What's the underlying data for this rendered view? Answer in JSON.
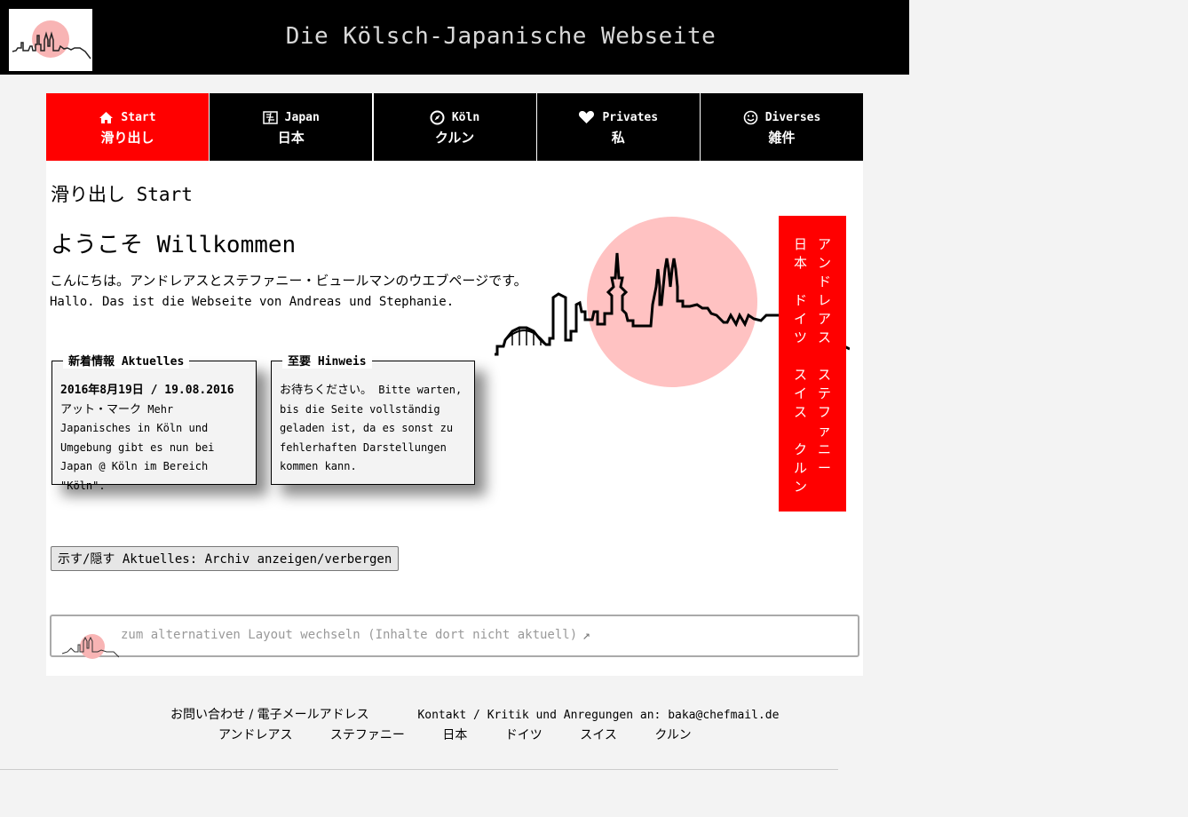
{
  "header": {
    "title": "Die Kölsch-Japanische Webseite"
  },
  "nav": [
    {
      "icon": "home-icon",
      "label_de": "Start",
      "label_jp": "滑り出し",
      "active": true
    },
    {
      "icon": "map-icon",
      "label_de": "Japan",
      "label_jp": "日本",
      "active": false
    },
    {
      "icon": "compass-icon",
      "label_de": "Köln",
      "label_jp": "クルン",
      "active": false
    },
    {
      "icon": "heart-icon",
      "label_de": "Privates",
      "label_jp": "私",
      "active": false
    },
    {
      "icon": "smiley-icon",
      "label_de": "Diverses",
      "label_jp": "雑件",
      "active": false
    }
  ],
  "main": {
    "page_title": "滑り出し Start",
    "welcome_title": "ようこそ Willkommen",
    "intro_jp": "こんにちは。アンドレアスとステファニー・ビュールマンのウエブページです。",
    "intro_de": "Hallo. Das ist die Webseite von Andreas und Stephanie."
  },
  "sidebar": {
    "names": [
      "ア",
      "ン",
      "ド",
      "レ",
      "ア",
      "ス",
      "",
      "ス",
      "テ",
      "フ",
      "ァ",
      "ニ",
      "ー"
    ],
    "places": [
      "日",
      "本",
      "",
      "ド",
      "イ",
      "ツ",
      "",
      "ス",
      "イ",
      "ス",
      "",
      "ク",
      "ル",
      "ン"
    ]
  },
  "news": {
    "legend": "新着情報 Aktuelles",
    "date": "2016年8月19日 / 19.08.2016",
    "text_jp": "アット・マーク",
    "text": "Mehr Japanisches in Köln und Umgebung gibt es nun bei Japan @ Köln im Bereich \"Köln\"."
  },
  "notice": {
    "legend": "至要 Hinweis",
    "text_jp": "お待ちください。",
    "text": "Bitte warten, bis die Seite vollständig geladen ist, da es sonst zu fehlerhaften Darstellungen kommen kann."
  },
  "toggle_button": "示す/隠す Aktuelles: Archiv anzeigen/verbergen",
  "alt_layout": {
    "text": "zum alternativen Layout wechseln (Inhalte dort nicht aktuell)",
    "arrow": "↗"
  },
  "footer": {
    "contact_jp": "お問い合わせ / 電子メールアドレス",
    "contact_de": "Kontakt / Kritik und Anregungen an:",
    "email": "baka@chefmail.de",
    "links": [
      "アンドレアス",
      "ステファニー",
      "日本",
      "ドイツ",
      "スイス",
      "クルン"
    ]
  },
  "colors": {
    "accent": "#ff0000",
    "nav_bg": "#000000",
    "circle": "#ffc0c0"
  }
}
